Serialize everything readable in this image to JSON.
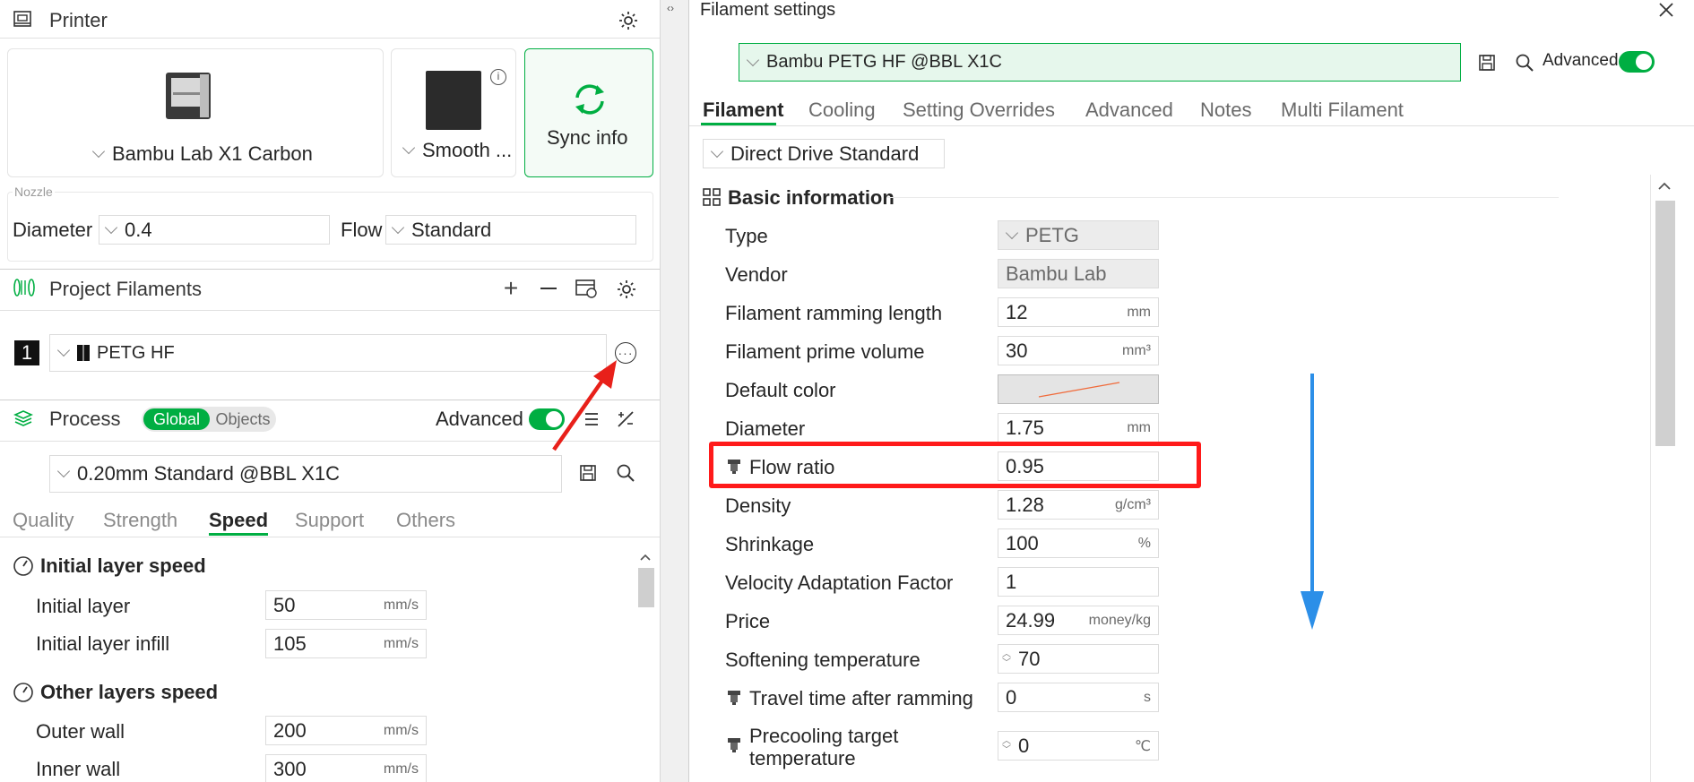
{
  "printer": {
    "title": "Printer",
    "printer_name": "Bambu Lab X1 Carbon",
    "plate_name": "Smooth ...",
    "sync_label": "Sync info",
    "nozzle_group_label": "Nozzle",
    "diameter_label": "Diameter",
    "diameter_value": "0.4",
    "flow_label": "Flow",
    "flow_value": "Standard"
  },
  "filaments": {
    "title": "Project Filaments",
    "items": [
      {
        "index": "1",
        "name": "PETG HF",
        "color": "#111111"
      }
    ]
  },
  "process": {
    "title": "Process",
    "scope_global": "Global",
    "scope_objects": "Objects",
    "advanced_label": "Advanced",
    "preset": "0.20mm Standard @BBL X1C",
    "tabs": [
      "Quality",
      "Strength",
      "Speed",
      "Support",
      "Others"
    ],
    "active_tab": "Speed",
    "groups": [
      {
        "title": "Initial layer speed",
        "rows": [
          {
            "label": "Initial layer",
            "value": "50",
            "unit": "mm/s"
          },
          {
            "label": "Initial layer infill",
            "value": "105",
            "unit": "mm/s"
          }
        ]
      },
      {
        "title": "Other layers speed",
        "rows": [
          {
            "label": "Outer wall",
            "value": "200",
            "unit": "mm/s"
          },
          {
            "label": "Inner wall",
            "value": "300",
            "unit": "mm/s"
          }
        ]
      }
    ]
  },
  "dialog": {
    "title": "Filament settings",
    "preset": "Bambu PETG HF @BBL X1C",
    "advanced_label": "Advanced",
    "tabs": [
      "Filament",
      "Cooling",
      "Setting Overrides",
      "Advanced",
      "Notes",
      "Multi Filament"
    ],
    "active_tab": "Filament",
    "extruder": "Direct Drive Standard",
    "section_title": "Basic information",
    "rows": [
      {
        "label": "Type",
        "value": "PETG",
        "unit": "",
        "kind": "readonly-combo"
      },
      {
        "label": "Vendor",
        "value": "Bambu Lab",
        "unit": "",
        "kind": "readonly"
      },
      {
        "label": "Filament ramming length",
        "value": "12",
        "unit": "mm",
        "kind": "text"
      },
      {
        "label": "Filament prime volume",
        "value": "30",
        "unit": "mm³",
        "kind": "text"
      },
      {
        "label": "Default color",
        "value": "",
        "unit": "",
        "kind": "color"
      },
      {
        "label": "Diameter",
        "value": "1.75",
        "unit": "mm",
        "kind": "text"
      },
      {
        "label": "Flow ratio",
        "value": "0.95",
        "unit": "",
        "kind": "text",
        "lock": true,
        "highlight": true
      },
      {
        "label": "Density",
        "value": "1.28",
        "unit": "g/cm³",
        "kind": "text"
      },
      {
        "label": "Shrinkage",
        "value": "100",
        "unit": "%",
        "kind": "text"
      },
      {
        "label": "Velocity Adaptation Factor",
        "value": "1",
        "unit": "",
        "kind": "text"
      },
      {
        "label": "Price",
        "value": "24.99",
        "unit": "money/kg",
        "kind": "text"
      },
      {
        "label": "Softening temperature",
        "value": "70",
        "unit": "",
        "kind": "spin"
      },
      {
        "label": "Travel time after ramming",
        "value": "0",
        "unit": "s",
        "kind": "text",
        "lock": true
      },
      {
        "label": "Precooling target temperature",
        "value": "0",
        "unit": "℃",
        "kind": "spin",
        "lock": true
      }
    ]
  },
  "colors": {
    "accent": "#00ae42",
    "highlight_box": "#ff1a1a",
    "annotation_arrow_red": "#e8201a",
    "annotation_arrow_blue": "#2c8fe8"
  }
}
